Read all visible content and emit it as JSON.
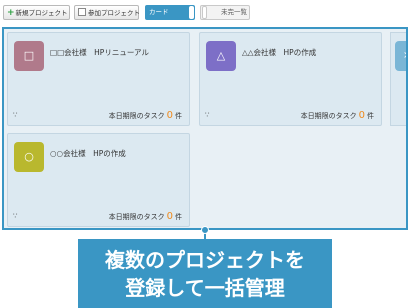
{
  "toolbar": {
    "new_project_label": "新規プロジェクト",
    "join_project_label": "参加プロジェクト",
    "card_view_label": "カード",
    "incomplete_label": "未完一覧"
  },
  "colors": {
    "accent": "#3a96c4",
    "card_bg": "#dce9f1",
    "count": "#f08a1c"
  },
  "cards": [
    {
      "symbol": "□",
      "color": "#b07a8b",
      "title": "□□会社様　HPリニューアル",
      "dots": "∵",
      "task_label": "本日期限のタスク",
      "count": "0",
      "unit": "件"
    },
    {
      "symbol": "△",
      "color": "#7d6fc7",
      "title": "△△会社様　HPの作成",
      "dots": "∵",
      "task_label": "本日期限のタスク",
      "count": "0",
      "unit": "件"
    },
    {
      "symbol": "○",
      "color": "#b9b82e",
      "title": "○○会社様　HPの作成",
      "dots": "∵",
      "task_label": "本日期限のタスク",
      "count": "0",
      "unit": "件"
    }
  ],
  "partial_card": {
    "symbol": "×",
    "color": "#7ab6d6"
  },
  "caption": {
    "line1": "複数のプロジェクトを",
    "line2": "登録して一括管理"
  }
}
